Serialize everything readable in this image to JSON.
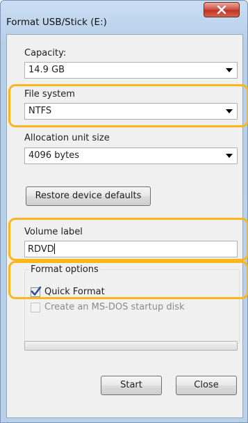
{
  "window": {
    "title": "Format USB/Stick (E:)",
    "close_glyph": "X"
  },
  "capacity": {
    "label": "Capacity:",
    "value": "14.9 GB"
  },
  "file_system": {
    "label": "File system",
    "value": "NTFS"
  },
  "allocation": {
    "label": "Allocation unit size",
    "value": "4096 bytes"
  },
  "restore_button": "Restore device defaults",
  "volume": {
    "label": "Volume label",
    "value": "RDVD"
  },
  "format_options": {
    "title": "Format options",
    "quick_format": {
      "label": "Quick Format",
      "checked": true
    },
    "msdos": {
      "label": "Create an MS-DOS startup disk",
      "checked": false,
      "enabled": false
    }
  },
  "progress": {
    "value": 0
  },
  "buttons": {
    "start": "Start",
    "close": "Close"
  },
  "colors": {
    "highlight": "#f9b71c",
    "close_button": "#c8402f",
    "check_mark": "#2a4f9a"
  },
  "icons": {
    "dropdown": "chevron-down-icon",
    "checkmark": "checkmark-icon",
    "close": "close-icon"
  }
}
